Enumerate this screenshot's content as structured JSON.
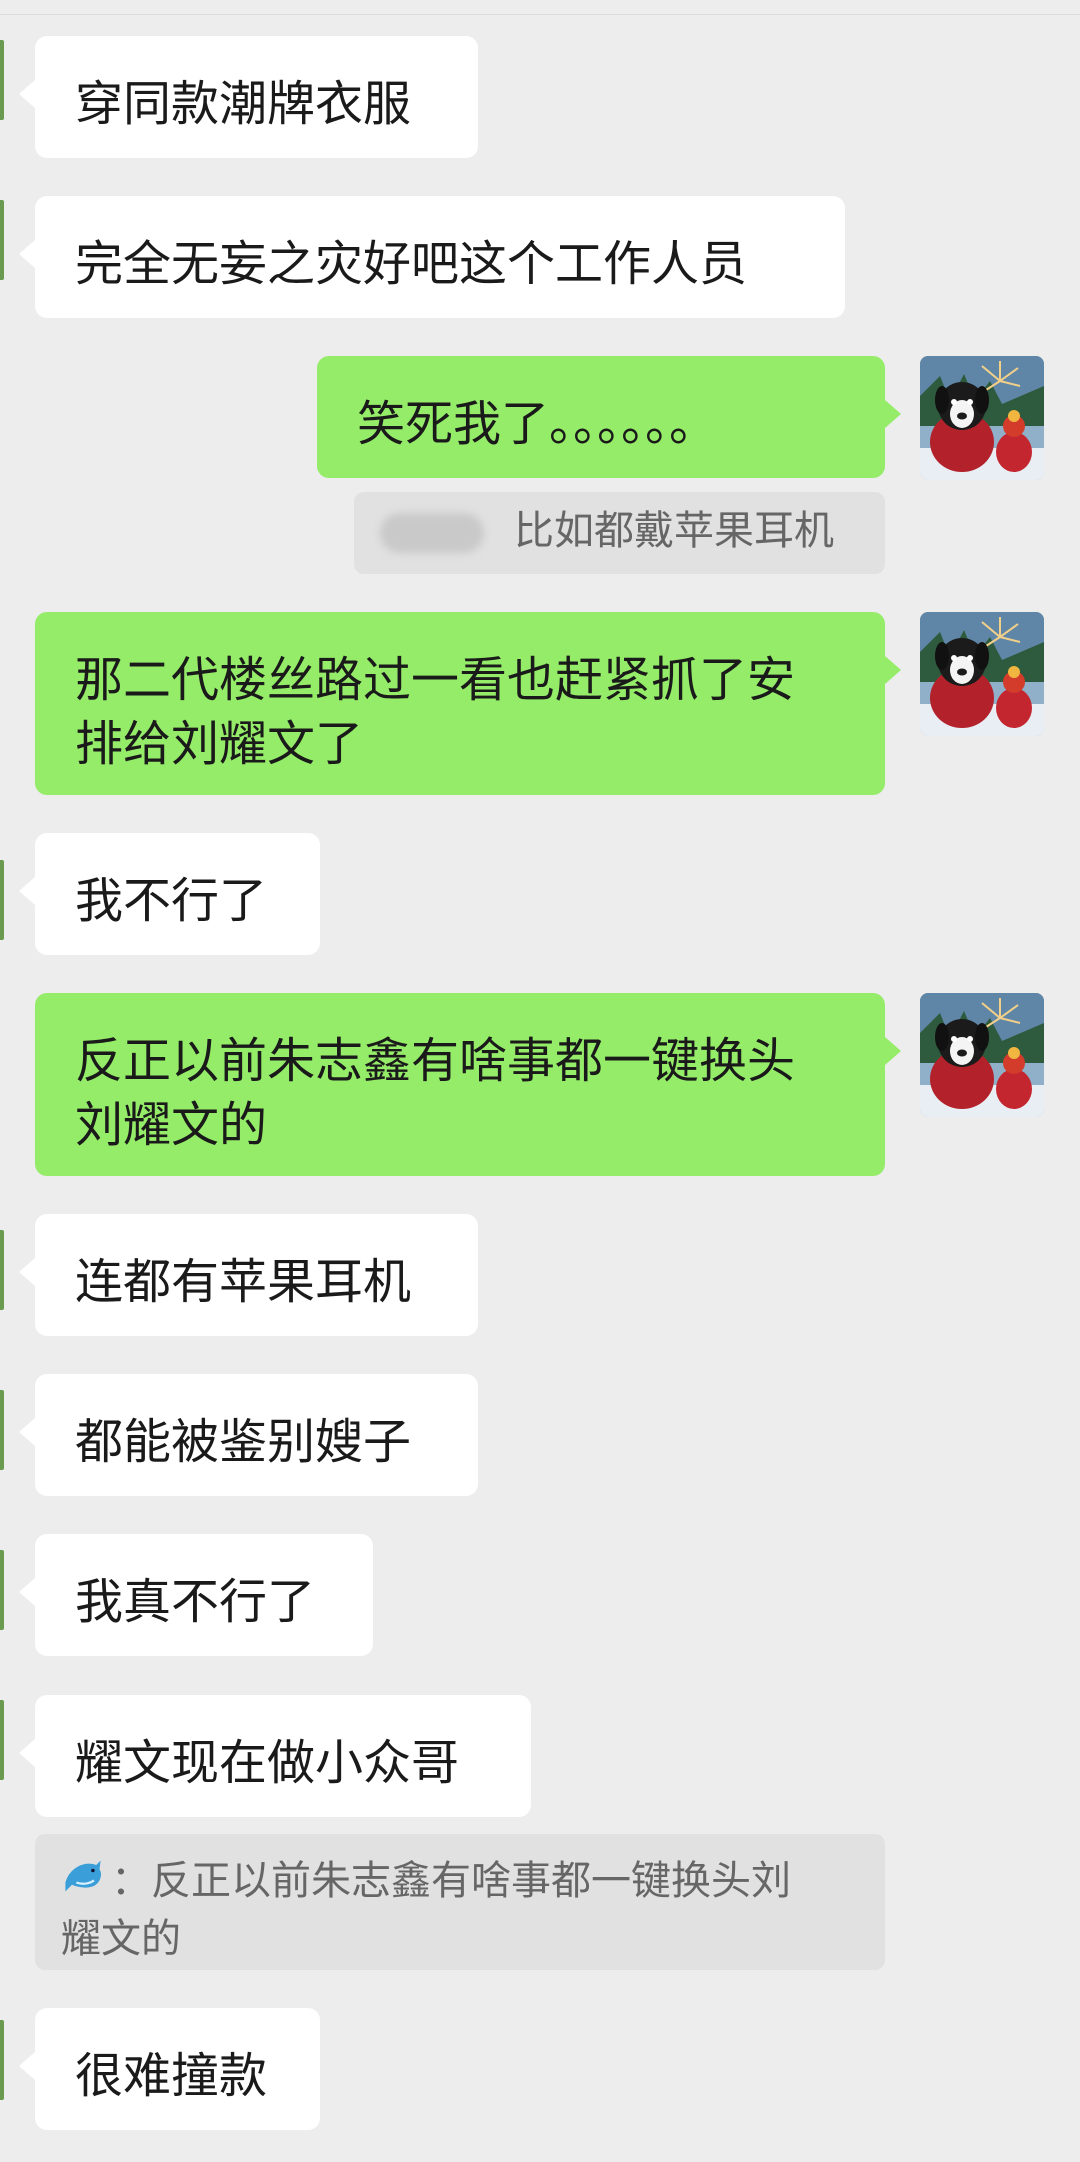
{
  "messages": [
    {
      "side": "left",
      "text": "穿同款潮牌衣服"
    },
    {
      "side": "left",
      "text": "完全无妄之灾好吧这个工作人员"
    },
    {
      "side": "right",
      "text": "笑死我了。。。。。。"
    },
    {
      "side": "quote",
      "text": "比如都戴苹果耳机"
    },
    {
      "side": "right",
      "line1": "那二代楼丝路过一看也赶紧抓了安",
      "line2": "排给刘耀文了"
    },
    {
      "side": "left",
      "text": "我不行了"
    },
    {
      "side": "right",
      "line1": "反正以前朱志鑫有啥事都一键换头",
      "line2": "刘耀文的"
    },
    {
      "side": "left",
      "text": "连都有苹果耳机"
    },
    {
      "side": "left",
      "text": "都能被鉴别嫂子"
    },
    {
      "side": "left",
      "text": "我真不行了"
    },
    {
      "side": "left",
      "text": "耀文现在做小众哥"
    },
    {
      "side": "quote",
      "line1": "：反正以前朱志鑫有啥事都一键换头刘",
      "line2": "耀文的"
    },
    {
      "side": "left",
      "text": "很难撞款"
    }
  ],
  "icons": {
    "avatar": "dog-in-red-sweater-avatar",
    "quote_sender": "dolphin-icon"
  },
  "colors": {
    "background": "#ededed",
    "incoming_bubble": "#ffffff",
    "outgoing_bubble": "#95ec69",
    "quote_background": "#e1e1e1",
    "quote_text": "#666666"
  }
}
